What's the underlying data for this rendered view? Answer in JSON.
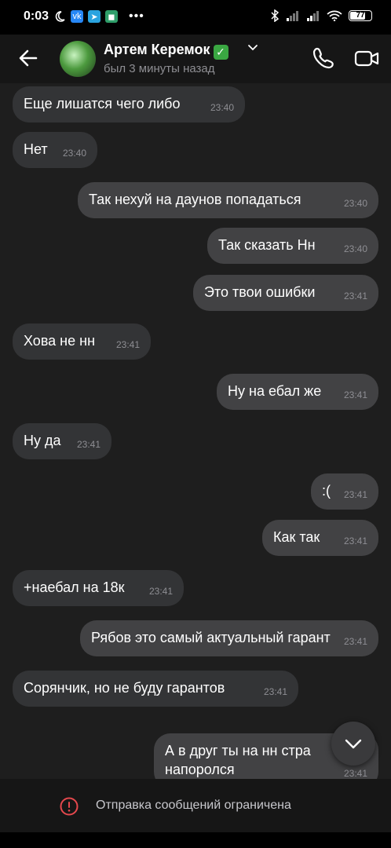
{
  "status_bar": {
    "time": "0:03",
    "battery": "77",
    "battery_level_percent": 77,
    "left_icons": [
      "moon-icon",
      "vk-icon",
      "telegram-icon",
      "app-icon",
      "more-dots-icon"
    ],
    "right_icons": [
      "bluetooth-icon",
      "signal-icon",
      "signal-icon",
      "wifi-icon",
      "battery-icon"
    ]
  },
  "header": {
    "name": "Артем Керемок",
    "verified_badge": "✅",
    "status": "был 3 минуты назад"
  },
  "messages": [
    {
      "dir": "in",
      "text": "Еще лишатся чего либо",
      "time": "23:40"
    },
    {
      "dir": "in",
      "text": "Нет",
      "time": "23:40"
    },
    {
      "dir": "out",
      "text": "Так нехуй на даунов попадаться",
      "time": "23:40"
    },
    {
      "dir": "out",
      "text": "Так сказать Нн",
      "time": "23:40"
    },
    {
      "dir": "out",
      "text": "Это твои ошибки",
      "time": "23:41"
    },
    {
      "dir": "in",
      "text": "Хова не нн",
      "time": "23:41"
    },
    {
      "dir": "out",
      "text": "Ну на ебал же",
      "time": "23:41"
    },
    {
      "dir": "in",
      "text": "Ну да",
      "time": "23:41"
    },
    {
      "dir": "out",
      "text": ":(",
      "time": "23:41"
    },
    {
      "dir": "out",
      "text": "Как так",
      "time": "23:41"
    },
    {
      "dir": "in",
      "text": "+наебал на 18к",
      "time": "23:41"
    },
    {
      "dir": "out",
      "text": "Рябов это самый актуальный гарант",
      "time": "23:41"
    },
    {
      "dir": "in",
      "text": "Сорянчик, но не буду гарантов",
      "time": "23:41"
    },
    {
      "dir": "out",
      "text": "А в друг ты на нн стра\nнапоролся",
      "time": "23:41"
    }
  ],
  "footer": {
    "notice": "Отправка сообщений ограничена"
  },
  "colors": {
    "background": "#1e1e1e",
    "incoming_bubble": "#333436",
    "outgoing_bubble": "#424244",
    "warning": "#e5484d",
    "verified": "#3aa742"
  }
}
